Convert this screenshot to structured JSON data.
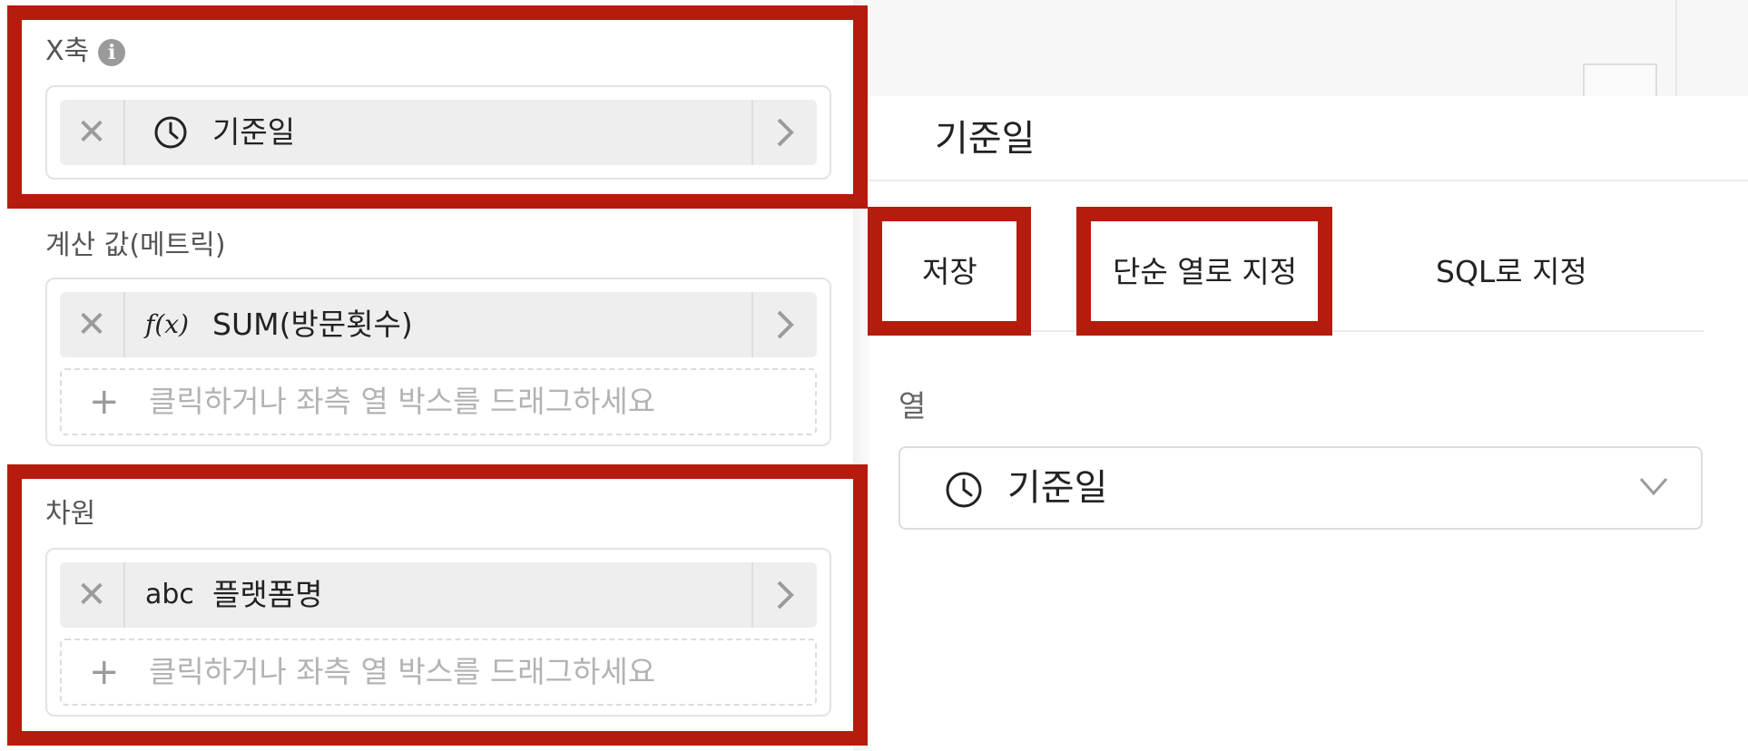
{
  "x_axis": {
    "label": "X축",
    "info_icon": "i",
    "field": {
      "icon": "clock-icon",
      "name": "기준일"
    }
  },
  "metrics": {
    "label": "계산 값(메트릭)",
    "field": {
      "icon": "function-icon",
      "icon_text": "f(x)",
      "name": "SUM(방문횟수)"
    },
    "dropzone_text": "클릭하거나 좌측 열 박스를 드래그하세요"
  },
  "dimension": {
    "label": "차원",
    "field": {
      "icon": "abc-icon",
      "icon_text": "abc",
      "name": "플랫폼명"
    },
    "dropzone_text": "클릭하거나 좌측 열 박스를 드래그하세요"
  },
  "common": {
    "remove_glyph": "✕",
    "add_glyph": "+"
  },
  "popover": {
    "title": "기준일",
    "tabs": [
      "저장",
      "단순 열로 지정",
      "SQL로 지정"
    ],
    "column_label": "열",
    "column_select": {
      "icon": "clock-icon",
      "value": "기준일"
    }
  },
  "colors": {
    "highlight": "#b51c0d",
    "pill_bg": "#eeeeee",
    "border": "#e3e3e3"
  }
}
